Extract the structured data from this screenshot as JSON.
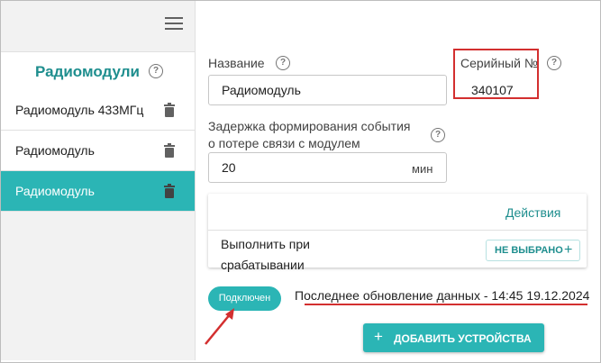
{
  "sidebar": {
    "title": "Радиомодули",
    "items": [
      {
        "label": "Радиомодуль 433МГц",
        "active": false
      },
      {
        "label": "Радиомодуль",
        "active": false
      },
      {
        "label": "Радиомодуль",
        "active": true
      }
    ]
  },
  "form": {
    "name_label": "Название",
    "name_value": "Радиомодуль",
    "serial_label": "Серийный №",
    "serial_value": "340107",
    "delay_label_line1": "Задержка формирования события",
    "delay_label_line2": "о потере связи с модулем",
    "delay_value": "20",
    "delay_unit": "мин"
  },
  "actions": {
    "title": "Действия",
    "trigger_line1": "Выполнить при",
    "trigger_line2": "срабатывании",
    "select_label": "НЕ ВЫБРАНО"
  },
  "status": {
    "badge": "Подключен",
    "last_update": "Последнее обновление данных - 14:45 19.12.2024"
  },
  "buttons": {
    "add_devices": "ДОБАВИТЬ УСТРОЙСТВА"
  },
  "colors": {
    "accent": "#2bb5b5",
    "accent_text": "#1e8e8e",
    "annotation": "#d32f2f"
  }
}
